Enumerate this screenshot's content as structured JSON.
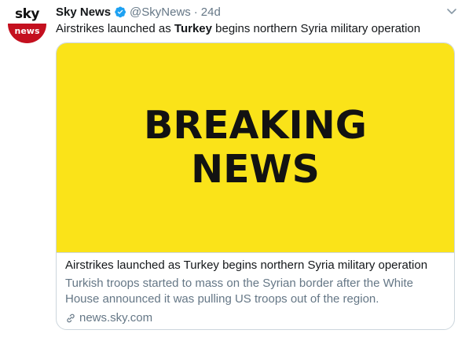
{
  "avatar": {
    "logo_top": "sky",
    "logo_bottom": "news"
  },
  "tweet": {
    "display_name": "Sky News",
    "handle": "@SkyNews",
    "separator": "·",
    "time": "24d",
    "text_before": "Airstrikes launched as ",
    "text_bold": "Turkey",
    "text_after": " begins northern Syria military operation"
  },
  "card": {
    "image_line1": "BREAKING",
    "image_line2": "NEWS",
    "title": "Airstrikes launched as Turkey begins northern Syria military operation",
    "description": "Turkish troops started to mass on the Syrian border after the White House announced it was pulling US troops out of the region.",
    "domain": "news.sky.com"
  },
  "colors": {
    "accent": "#1da1f2",
    "card_image_bg": "#fae319",
    "secondary_text": "#657786",
    "sky_red": "#c4101f"
  },
  "icons": {
    "verified": "verified-badge-icon",
    "caret": "chevron-down-icon",
    "link": "link-icon"
  }
}
